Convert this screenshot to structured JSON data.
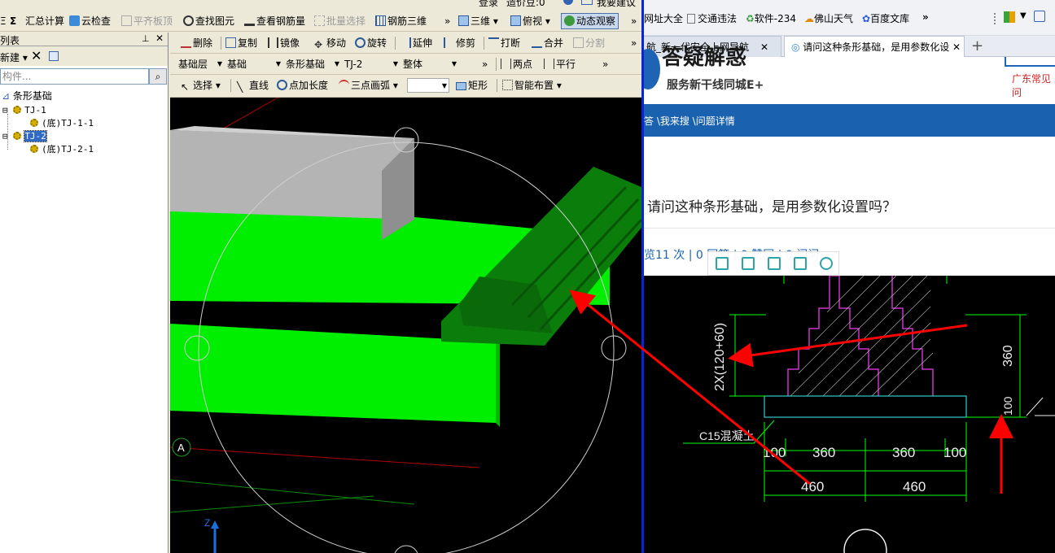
{
  "app": {
    "topbar": {
      "items": [
        "登录",
        "造价豆:0",
        "我要建议"
      ]
    },
    "toolbar1": {
      "items": [
        {
          "label": "汇总计算",
          "icon": "sigma-icon"
        },
        {
          "label": "云检查",
          "icon": "cloud-check-icon"
        },
        {
          "label": "平齐板顶",
          "icon": "align-top-icon",
          "disabled": true
        },
        {
          "label": "查找图元",
          "icon": "binoculars-icon"
        },
        {
          "label": "查看钢筋量",
          "icon": "glasses-icon"
        },
        {
          "label": "批量选择",
          "icon": "batch-select-icon",
          "disabled": true
        },
        {
          "label": "钢筋三维",
          "icon": "rebar-3d-icon"
        },
        {
          "label": "三维",
          "icon": "cube-icon"
        },
        {
          "label": "俯视",
          "icon": "top-view-icon"
        },
        {
          "label": "动态观察",
          "icon": "orbit-icon"
        }
      ],
      "left_chars": [
        "Ξ",
        "Σ"
      ],
      "more": "»"
    },
    "toolbar2": {
      "items": [
        {
          "label": "删除",
          "icon": "delete-icon"
        },
        {
          "label": "复制",
          "icon": "copy-icon"
        },
        {
          "label": "镜像",
          "icon": "mirror-icon"
        },
        {
          "label": "移动",
          "icon": "move-icon"
        },
        {
          "label": "旋转",
          "icon": "rotate-icon"
        },
        {
          "label": "延伸",
          "icon": "extend-icon"
        },
        {
          "label": "修剪",
          "icon": "trim-icon"
        },
        {
          "label": "打断",
          "icon": "break-icon"
        },
        {
          "label": "合并",
          "icon": "merge-icon"
        },
        {
          "label": "分割",
          "icon": "split-icon",
          "disabled": true
        }
      ],
      "more": "»"
    },
    "toolbar3": {
      "selects": [
        "基础层",
        "基础",
        "条形基础",
        "TJ-2",
        "整体"
      ],
      "items": [
        {
          "label": "两点",
          "icon": "two-point-icon"
        },
        {
          "label": "平行",
          "icon": "parallel-icon"
        }
      ],
      "more": "»"
    },
    "toolbar4": {
      "items": [
        {
          "label": "选择",
          "icon": "cursor-icon"
        },
        {
          "label": "直线",
          "icon": "line-icon"
        },
        {
          "label": "点加长度",
          "icon": "point-length-icon"
        },
        {
          "label": "三点画弧",
          "icon": "arc-icon"
        },
        {
          "label": "矩形",
          "icon": "rectangle-icon"
        },
        {
          "label": "智能布置",
          "icon": "smart-layout-icon"
        }
      ]
    },
    "left_panel": {
      "title": "列表",
      "new_label": "新建",
      "search_placeholder": "构件...",
      "tree": {
        "root": "条形基础",
        "nodes": [
          {
            "label": "TJ-1",
            "child": "(底)TJ-1-1"
          },
          {
            "label": "TJ-2",
            "child": "(底)TJ-2-1",
            "selected": true
          }
        ]
      }
    },
    "viewport": {
      "axis_label": "A",
      "z_label": "Z",
      "colors": {
        "bright_green": "#00ee00",
        "dark_green": "#0b7d0b",
        "grey_beam": "#b4b4b4",
        "red_arrow": "#ff0000"
      }
    }
  },
  "browser": {
    "bookmarks": [
      "网址大全",
      "交通违法",
      "软件-234",
      "佛山天气",
      "百度文库"
    ],
    "bookmarks_more": "»",
    "tabs": [
      {
        "label": "航_新一代安全上网导航"
      },
      {
        "label": "请问这种条形基础，是用参数化设",
        "active": true
      }
    ],
    "new_tab": "+",
    "banner": {
      "title": "答疑解惑",
      "subtitle": "服务新干线同城E+",
      "right": "广东常见问"
    },
    "breadcrumb": "答 \\我来搜 \\问题详情",
    "question": "请问这种条形基础，是用参数化设置吗？",
    "stats": "览11 次 | 0 回答 | 0 赞同 | 0 问问",
    "cad": {
      "dims": {
        "v1": "2X(120+60)",
        "v2": "360",
        "v3": "100",
        "h_row1": [
          "100",
          "360",
          "360",
          "100"
        ],
        "h_row2": [
          "460",
          "460"
        ]
      },
      "label": "C15混凝土"
    }
  }
}
